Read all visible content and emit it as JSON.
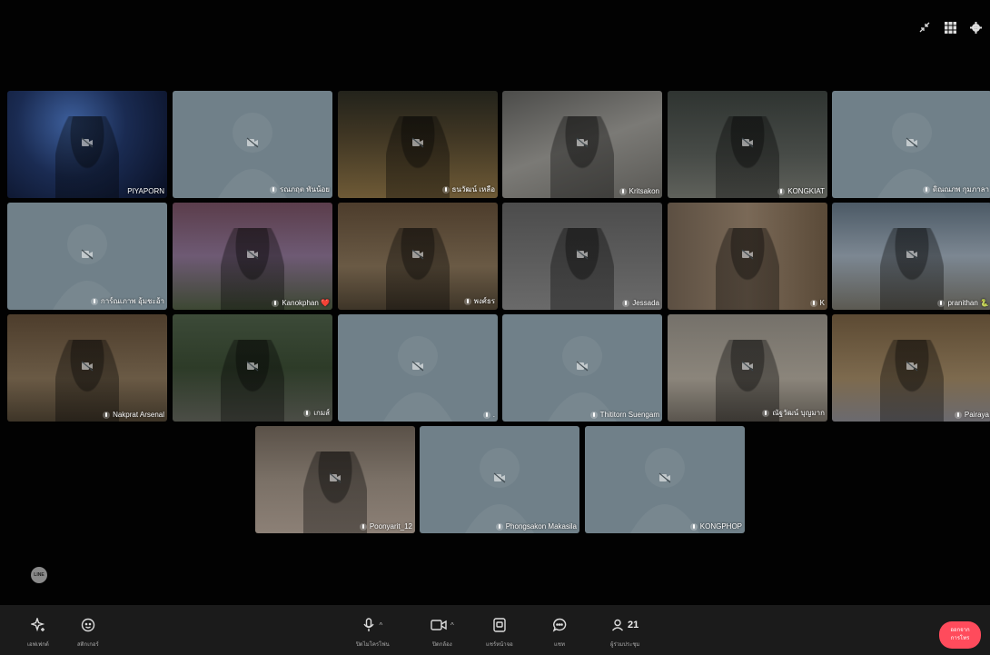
{
  "top_icons": [
    "minimize-icon",
    "grid-view-icon",
    "settings-icon"
  ],
  "participants": [
    {
      "name": "PIYAPORN",
      "camera": true,
      "scene": "space",
      "mic_icon": false
    },
    {
      "name": "รณภฤต พันน้อย",
      "camera": false,
      "scene": "",
      "mic_icon": true
    },
    {
      "name": "ธนวัฒน์ เหลือ",
      "camera": true,
      "scene": "temple",
      "mic_icon": true
    },
    {
      "name": "Kritsakon",
      "camera": true,
      "scene": "street",
      "mic_icon": true
    },
    {
      "name": "KONGKIAT",
      "camera": true,
      "scene": "garage",
      "mic_icon": true
    },
    {
      "name": "ดิณณภพ กุมภาลา",
      "camera": false,
      "scene": "",
      "mic_icon": true
    },
    {
      "name": "การ์ณเภาพ อุ้มชะอ้า",
      "camera": false,
      "scene": "",
      "mic_icon": true
    },
    {
      "name": "Kanokphan ❤️",
      "camera": true,
      "scene": "purple",
      "mic_icon": true
    },
    {
      "name": "พงศ์ธร",
      "camera": true,
      "scene": "room",
      "mic_icon": true
    },
    {
      "name": "Jessada",
      "camera": true,
      "scene": "gray",
      "mic_icon": true
    },
    {
      "name": "K",
      "camera": true,
      "scene": "door",
      "mic_icon": true
    },
    {
      "name": "pranithan 🐍",
      "camera": true,
      "scene": "outdoor",
      "mic_icon": true
    },
    {
      "name": "Nakprat Arsenal",
      "camera": true,
      "scene": "room",
      "mic_icon": true
    },
    {
      "name": "เกมส์",
      "camera": true,
      "scene": "jungle",
      "mic_icon": true
    },
    {
      "name": ".",
      "camera": false,
      "scene": "",
      "mic_icon": true
    },
    {
      "name": "Thititorn Suengam",
      "camera": false,
      "scene": "",
      "mic_icon": true
    },
    {
      "name": "ณัฐวัฒน์ บุญมาก",
      "camera": true,
      "scene": "indoor",
      "mic_icon": true
    },
    {
      "name": "Pairaya",
      "camera": true,
      "scene": "cafe",
      "mic_icon": true
    },
    {
      "name": "Poonyarit_12",
      "camera": true,
      "scene": "ground",
      "mic_icon": true
    },
    {
      "name": "Phongsakon Makasila",
      "camera": false,
      "scene": "",
      "mic_icon": true
    },
    {
      "name": "KONGPHOP",
      "camera": false,
      "scene": "",
      "mic_icon": true
    }
  ],
  "line_logo": "LINE",
  "toolbar": {
    "effects_label": "เอฟเฟกต์",
    "stickers_label": "สติกเกอร์",
    "mic_label": "ปิดไมโครโฟน",
    "camera_label": "ปิดกล้อง",
    "share_label": "แชร์หน้าจอ",
    "chat_label": "แชท",
    "participants_label": "ผู้ร่วมประชุม",
    "participants_count": "21",
    "leave_label_1": "ออกจาก",
    "leave_label_2": "การโทร"
  },
  "colors": {
    "leave": "#ff4b5c",
    "tile_off": "#708089",
    "bar": "#1b1b1b"
  }
}
